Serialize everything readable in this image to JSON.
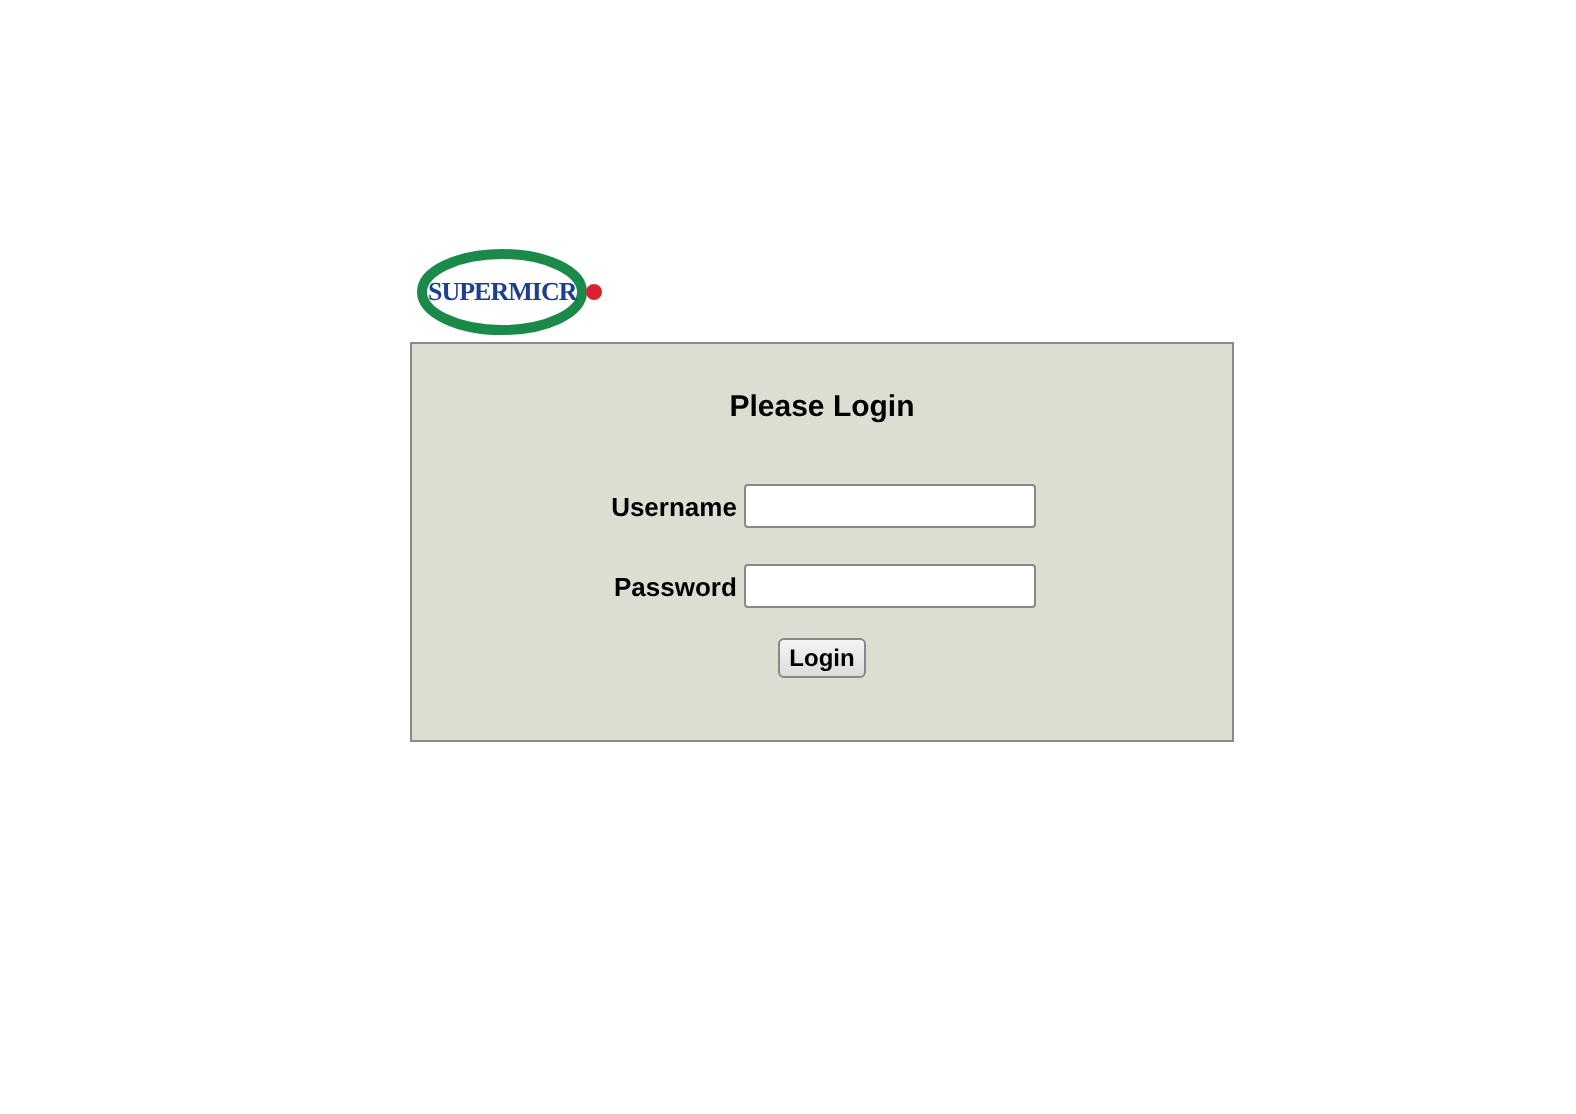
{
  "logo": {
    "text": "SUPERMICR"
  },
  "login_panel": {
    "title": "Please Login",
    "fields": [
      {
        "label": "Username"
      },
      {
        "label": "Password"
      }
    ],
    "button": "Login"
  }
}
